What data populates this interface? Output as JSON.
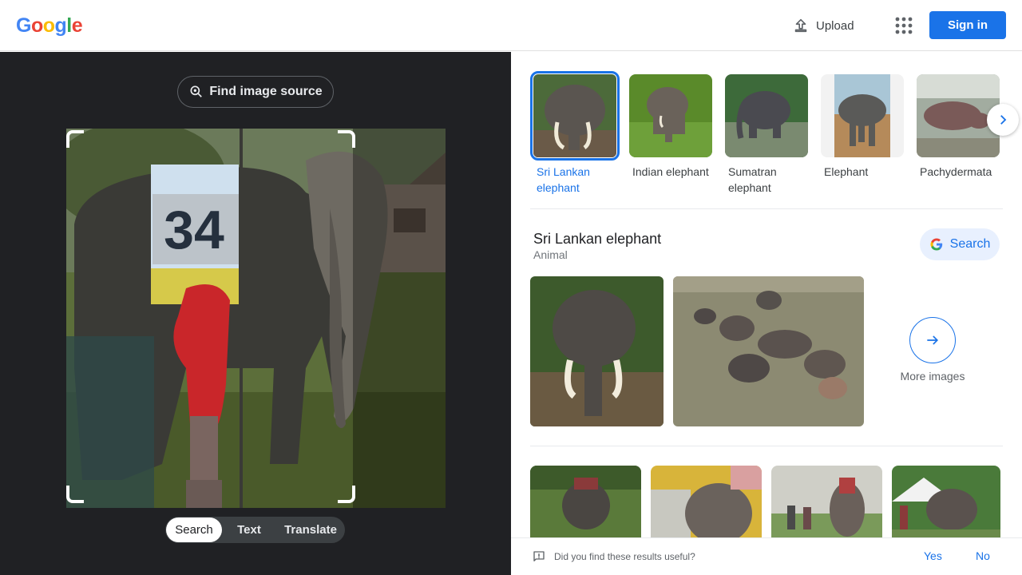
{
  "header": {
    "logo_letters": [
      {
        "char": "G",
        "color": "#4285F4"
      },
      {
        "char": "o",
        "color": "#EA4335"
      },
      {
        "char": "o",
        "color": "#FBBC05"
      },
      {
        "char": "g",
        "color": "#4285F4"
      },
      {
        "char": "l",
        "color": "#34A853"
      },
      {
        "char": "e",
        "color": "#EA4335"
      }
    ],
    "upload_label": "Upload",
    "apps_icon": "apps-grid-icon",
    "sign_in_label": "Sign in"
  },
  "image_panel": {
    "find_source_label": "Find image source",
    "bib_number": "34",
    "modes": {
      "search": "Search",
      "text": "Text",
      "translate": "Translate"
    },
    "active_mode": "Search"
  },
  "results": {
    "entities": [
      {
        "label": "Sri Lankan elephant",
        "selected": true
      },
      {
        "label": "Indian elephant",
        "selected": false
      },
      {
        "label": "Sumatran elephant",
        "selected": false
      },
      {
        "label": "Elephant",
        "selected": false
      },
      {
        "label": "Pachydermata",
        "selected": false
      }
    ],
    "knowledge": {
      "title": "Sri Lankan elephant",
      "subtitle": "Animal",
      "search_label": "Search",
      "more_images_label": "More images"
    },
    "feedback": {
      "question": "Did you find these results useful?",
      "yes": "Yes",
      "no": "No"
    }
  },
  "colors": {
    "accent": "#1a73e8",
    "dark_panel": "#202124"
  }
}
